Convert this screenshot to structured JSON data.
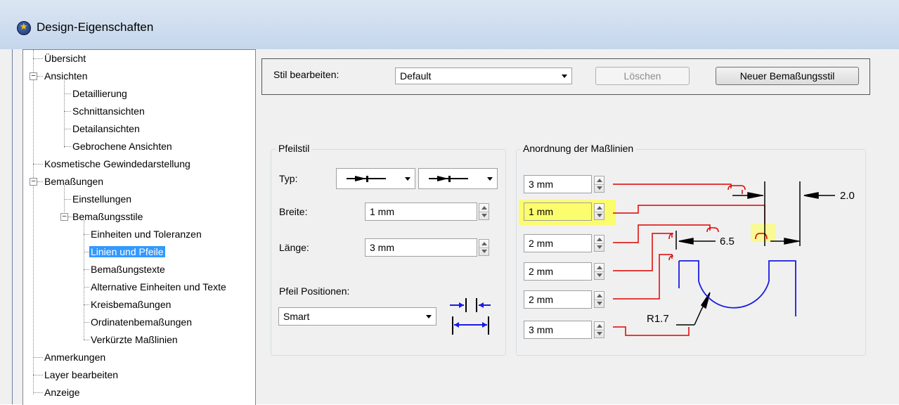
{
  "window": {
    "title": "Design-Eigenschaften"
  },
  "tree": {
    "items": [
      {
        "label": "Übersicht"
      },
      {
        "label": "Ansichten"
      },
      {
        "label": "Detaillierung"
      },
      {
        "label": "Schnittansichten"
      },
      {
        "label": "Detailansichten"
      },
      {
        "label": "Gebrochene Ansichten"
      },
      {
        "label": "Kosmetische Gewindedarstellung"
      },
      {
        "label": "Bemaßungen"
      },
      {
        "label": "Einstellungen"
      },
      {
        "label": "Bemaßungsstile"
      },
      {
        "label": "Einheiten und Toleranzen"
      },
      {
        "label": "Linien und Pfeile"
      },
      {
        "label": "Bemaßungstexte"
      },
      {
        "label": "Alternative Einheiten und Texte"
      },
      {
        "label": "Kreisbemaßungen"
      },
      {
        "label": "Ordinatenbemaßungen"
      },
      {
        "label": "Verkürzte Maßlinien"
      },
      {
        "label": "Anmerkungen"
      },
      {
        "label": "Layer bearbeiten"
      },
      {
        "label": "Anzeige"
      }
    ],
    "selected": "Linien und Pfeile"
  },
  "style_bar": {
    "label": "Stil bearbeiten:",
    "value": "Default",
    "delete_button": "Löschen",
    "new_button": "Neuer Bemaßungsstil"
  },
  "arrow_style": {
    "group_title": "Pfeilstil",
    "type_label": "Typ:",
    "width_label": "Breite:",
    "width_value": "1 mm",
    "length_label": "Länge:",
    "length_value": "3 mm",
    "positions_label": "Pfeil Positionen:",
    "positions_value": "Smart"
  },
  "dim_layout": {
    "group_title": "Anordnung der Maßlinien",
    "values": [
      "3 mm",
      "1 mm",
      "2 mm",
      "2 mm",
      "2 mm",
      "3 mm"
    ],
    "highlighted_index": 1,
    "preview_labels": {
      "right": "2.0",
      "middle": "6.5",
      "radius": "R1.7"
    }
  },
  "colors": {
    "highlight": "#fcfc6f",
    "selection": "#3399ff",
    "preview_red": "#e00000",
    "preview_blue": "#1a1ae6"
  }
}
